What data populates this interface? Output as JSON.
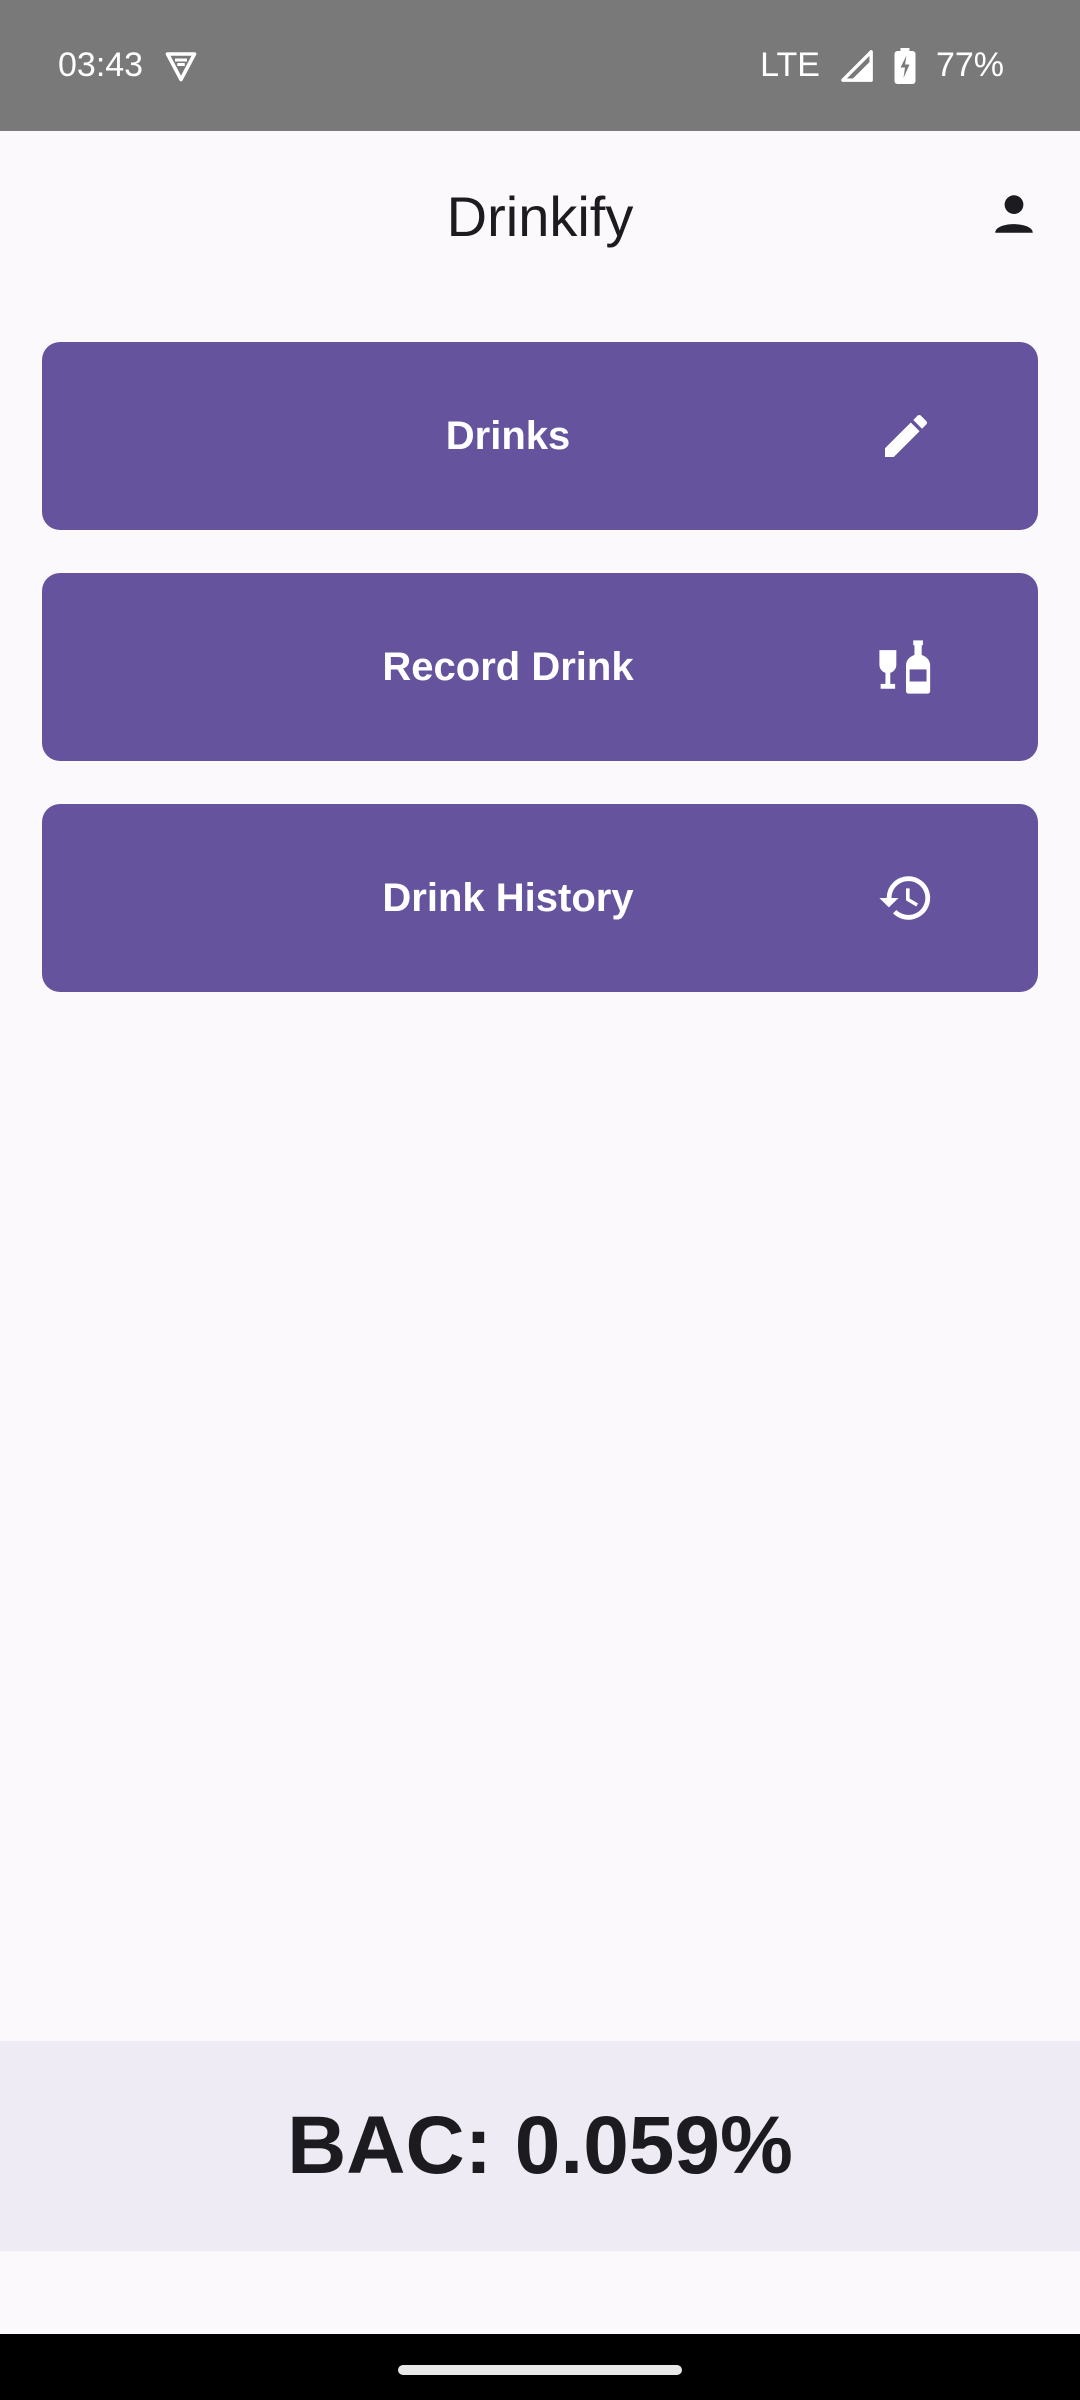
{
  "status_bar": {
    "time": "03:43",
    "network": "LTE",
    "battery": "77%",
    "icons": [
      "vpn-shield-icon",
      "signal-icon",
      "battery-charging-icon"
    ]
  },
  "app_bar": {
    "title": "Drinkify",
    "profile_icon": "person-icon"
  },
  "menu": {
    "items": [
      {
        "label": "Drinks",
        "icon": "pencil-icon"
      },
      {
        "label": "Record Drink",
        "icon": "wine-bottle-icon"
      },
      {
        "label": "Drink History",
        "icon": "history-icon"
      }
    ]
  },
  "bac": {
    "text": "BAC: 0.059%"
  },
  "colors": {
    "primary": "#65539e",
    "background": "#fcf9fd",
    "panel": "#efebf4",
    "status_bar": "#797979"
  }
}
